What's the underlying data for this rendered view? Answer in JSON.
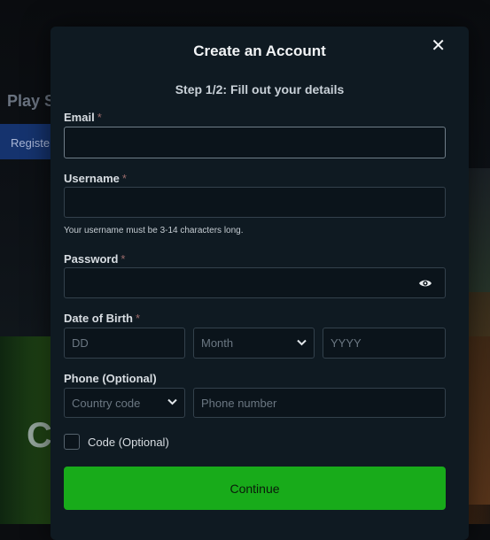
{
  "background": {
    "title": "Play S",
    "tab": "Registe",
    "letter": "C"
  },
  "modal": {
    "title": "Create an Account",
    "close_label": "✕",
    "step": "Step 1/2: Fill out your details",
    "email": {
      "label": "Email",
      "required": "*",
      "value": ""
    },
    "username": {
      "label": "Username",
      "required": "*",
      "value": "",
      "hint": "Your username must be 3-14 characters long."
    },
    "password": {
      "label": "Password",
      "required": "*",
      "value": ""
    },
    "dob": {
      "label": "Date of Birth",
      "required": "*",
      "day_placeholder": "DD",
      "month_value": "Month",
      "year_placeholder": "YYYY"
    },
    "phone": {
      "label": "Phone (Optional)",
      "country_value": "Country code",
      "number_placeholder": "Phone number"
    },
    "code": {
      "label": "Code (Optional)",
      "checked": false
    },
    "continue_label": "Continue"
  },
  "colors": {
    "modal_bg": "#0f1a22",
    "primary_button": "#18ab1a",
    "field_bg": "#0b141b",
    "field_border": "#33414c"
  },
  "icons": {
    "close": "close-icon",
    "password_toggle": "eye-icon",
    "dropdown": "chevron-down-icon"
  }
}
